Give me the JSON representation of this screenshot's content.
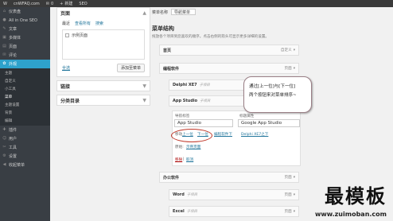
{
  "adminbar": {
    "logo": "W",
    "site": "cnWFAQ.com",
    "comments": "0",
    "new": "新建",
    "seo": "SEO"
  },
  "sidebar": {
    "items": [
      {
        "icon": "dashboard-icon",
        "glyph": "⌂",
        "label": "仪表盘"
      },
      {
        "icon": "seo-icon",
        "glyph": "●",
        "label": "All in One SEO"
      },
      {
        "icon": "posts-icon",
        "glyph": "✎",
        "label": "文章"
      },
      {
        "icon": "media-icon",
        "glyph": "▣",
        "label": "多媒体"
      },
      {
        "icon": "pages-icon",
        "glyph": "▤",
        "label": "页面"
      },
      {
        "icon": "comments-icon",
        "glyph": "✉",
        "label": "评论"
      },
      {
        "icon": "appearance-icon",
        "glyph": "✿",
        "label": "外观"
      }
    ],
    "submenu": [
      "主题",
      "自定义",
      "小工具",
      "菜单",
      "主题设置",
      "背景",
      "编辑"
    ],
    "bottom_items": [
      {
        "icon": "plugins-icon",
        "glyph": "✚",
        "label": "插件"
      },
      {
        "icon": "users-icon",
        "glyph": "☺",
        "label": "用户"
      },
      {
        "icon": "tools-icon",
        "glyph": "✂",
        "label": "工具"
      },
      {
        "icon": "settings-icon",
        "glyph": "⚙",
        "label": "设置"
      },
      {
        "icon": "collapse-icon",
        "glyph": "◀",
        "label": "收起菜单"
      }
    ]
  },
  "pages_box": {
    "title": "页面",
    "tabs": [
      "最近",
      "查看所有",
      "搜索"
    ],
    "item": "示例页面",
    "select_all": "全选",
    "add_button": "添加至菜单"
  },
  "links_box": {
    "title": "链接"
  },
  "categories_box": {
    "title": "分类目录"
  },
  "menu": {
    "name_label": "菜单名称",
    "name_value": "导航菜单",
    "structure_title": "菜单结构",
    "structure_desc": "拖放各个项目到您喜欢的顺序。点击右侧的箭头可显示更多详细的设置。",
    "items": [
      {
        "title": "首页",
        "sub": "",
        "meta": "自定义"
      },
      {
        "title": "编程软件",
        "sub": "",
        "meta": "页面"
      },
      {
        "title": "Delphi XE7",
        "sub": "子项目",
        "meta": "页面"
      },
      {
        "title": "App Studio",
        "sub": "子项目",
        "meta": "页面"
      },
      {
        "title": "办公软件",
        "sub": "",
        "meta": "页面"
      },
      {
        "title": "Word",
        "sub": "子项目",
        "meta": "页面"
      },
      {
        "title": "Excel",
        "sub": "子项目",
        "meta": "页面"
      }
    ],
    "edit": {
      "nav_label_label": "导航标签",
      "nav_label_value": "App Studio",
      "title_attr_label": "标题属性",
      "title_attr_value": "Google App Studio",
      "move_label": "移动",
      "move_up": "上一位",
      "move_down": "下一位",
      "move_out": "编程软件下",
      "move_under": "Delphi XE7之下",
      "original_label": "原始:",
      "original_value": "示例页面",
      "remove": "移除",
      "cancel": "取消"
    }
  },
  "callout": {
    "line1": "通过[上一位]与[下一位]",
    "line2": "两个按钮来对菜单排序~"
  },
  "watermark": {
    "text": "最模板",
    "url": "www.zuimoban.com"
  }
}
